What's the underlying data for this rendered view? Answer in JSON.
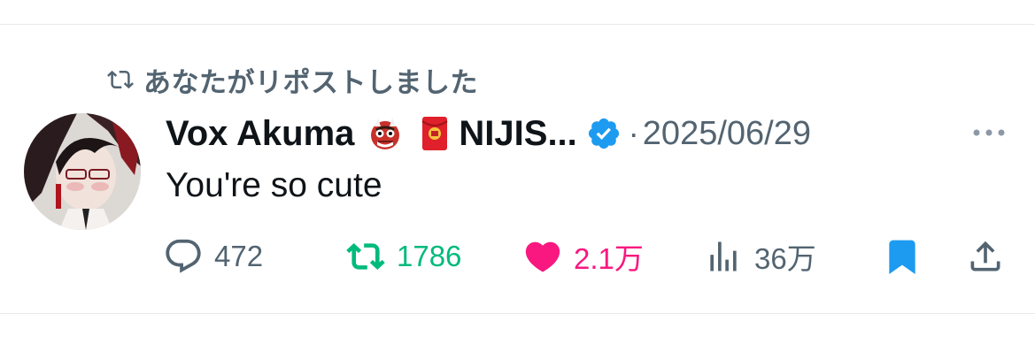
{
  "repost_banner": {
    "text": "あなたがリポストしました",
    "icon": "repost-icon"
  },
  "tweet": {
    "author_name": "Vox Akuma",
    "author_emoji_1": "ogre-face-emoji",
    "author_emoji_2": "red-envelope-emoji",
    "author_name_suffix": "NIJIS...",
    "verified_icon": "verified-badge-icon",
    "separator": "·",
    "date": "2025/06/29",
    "text": "You're so cute"
  },
  "actions": {
    "replies": {
      "count": "472",
      "icon": "reply-icon"
    },
    "reposts": {
      "count": "1786",
      "icon": "repost-icon",
      "active": true
    },
    "likes": {
      "count": "2.1万",
      "icon": "heart-icon",
      "active": true
    },
    "views": {
      "count": "36万",
      "icon": "views-icon"
    },
    "bookmark": {
      "icon": "bookmark-icon",
      "active": true
    },
    "share": {
      "icon": "share-icon"
    }
  },
  "colors": {
    "muted": "#536471",
    "text": "#0f1419",
    "repost_green": "#00ba7c",
    "like_pink": "#f91880",
    "bookmark_blue": "#1d9bf0",
    "verified_blue": "#1d9bf0"
  }
}
